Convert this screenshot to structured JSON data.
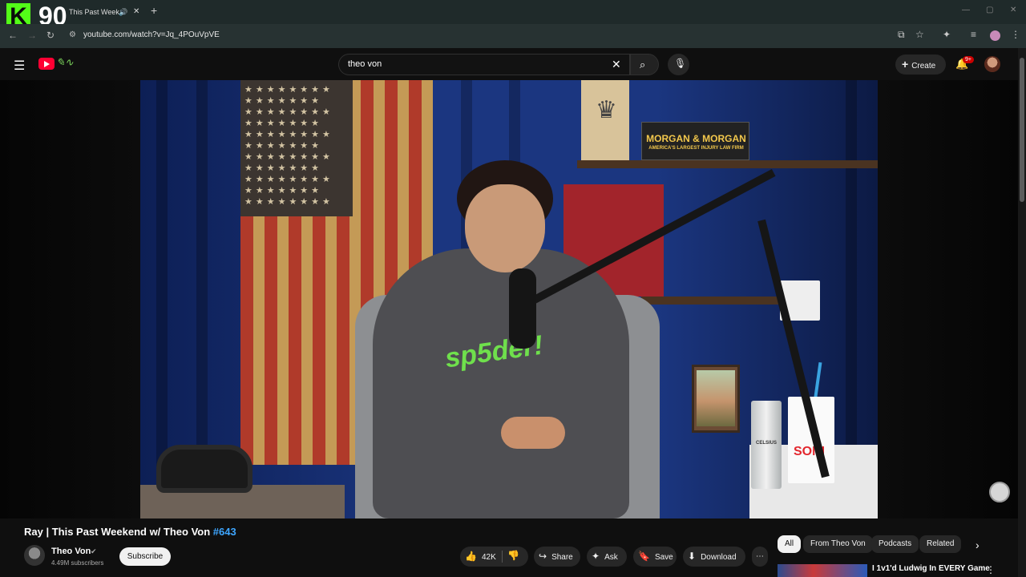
{
  "overlay": {
    "badge_letter": "K",
    "count": "90"
  },
  "browser": {
    "tab_title": "This Past Week",
    "audio_icon": "🔊",
    "close_icon": "✕",
    "newtab_icon": "+",
    "url": "youtube.com/watch?v=Jq_4POuVpVE"
  },
  "masthead": {
    "search_value": "theo von",
    "create_label": "Create",
    "notification_count": "9+"
  },
  "video": {
    "sponsor_title": "MORGAN & MORGAN",
    "sponsor_sub": "AMERICA'S LARGEST INJURY LAW FIRM",
    "hoodie_text": "sp5der!",
    "can_text": "CELSIUS",
    "cup_text": "SONI"
  },
  "watch": {
    "title": "Ray | This Past Weekend w/ Theo Von",
    "hashtag": "#643",
    "channel_name": "Theo Von",
    "subscribers": "4.49M subscribers",
    "subscribe_label": "Subscribe",
    "likes": "42K",
    "share_label": "Share",
    "ask_label": "Ask",
    "save_label": "Save",
    "download_label": "Download"
  },
  "chips": [
    "All",
    "From Theo Von",
    "Podcasts",
    "Related"
  ],
  "recommendation": {
    "title": "I 1v1'd Ludwig In EVERY Game"
  },
  "colors": {
    "accent": "#ff0033",
    "kick_green": "#53fc18",
    "link": "#3ea6ff"
  }
}
